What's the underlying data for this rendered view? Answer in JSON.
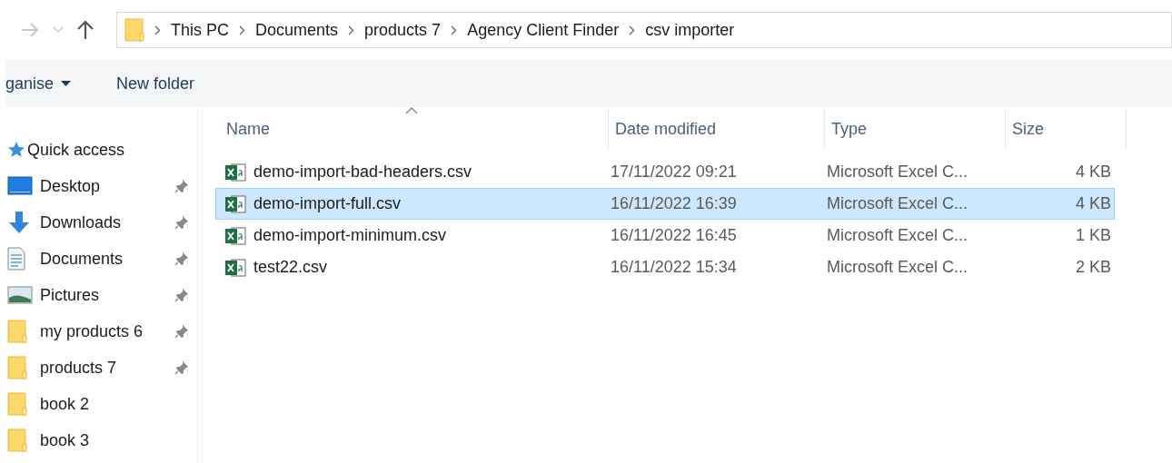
{
  "breadcrumb": [
    "This PC",
    "Documents",
    "products 7",
    "Agency Client Finder",
    "csv importer"
  ],
  "toolbar": {
    "organise": "ganise",
    "new_folder": "New folder"
  },
  "sidebar": {
    "items": [
      {
        "kind": "quick",
        "label": "Quick access",
        "pinned": false
      },
      {
        "kind": "desktop",
        "label": "Desktop",
        "pinned": true
      },
      {
        "kind": "downloads",
        "label": "Downloads",
        "pinned": true
      },
      {
        "kind": "documents",
        "label": "Documents",
        "pinned": true
      },
      {
        "kind": "pictures",
        "label": "Pictures",
        "pinned": true
      },
      {
        "kind": "folder",
        "label": "my products 6",
        "pinned": true
      },
      {
        "kind": "folder",
        "label": "products 7",
        "pinned": true
      },
      {
        "kind": "folder",
        "label": "book 2",
        "pinned": false
      },
      {
        "kind": "folder",
        "label": "book 3",
        "pinned": false
      }
    ]
  },
  "table": {
    "columns": [
      "Name",
      "Date modified",
      "Type",
      "Size"
    ],
    "rows": [
      {
        "name": "demo-import-bad-headers.csv",
        "date": "17/11/2022 09:21",
        "type": "Microsoft Excel C...",
        "size": "4 KB",
        "selected": false
      },
      {
        "name": "demo-import-full.csv",
        "date": "16/11/2022 16:39",
        "type": "Microsoft Excel C...",
        "size": "4 KB",
        "selected": true
      },
      {
        "name": "demo-import-minimum.csv",
        "date": "16/11/2022 16:45",
        "type": "Microsoft Excel C...",
        "size": "1 KB",
        "selected": false
      },
      {
        "name": "test22.csv",
        "date": "16/11/2022 15:34",
        "type": "Microsoft Excel C...",
        "size": "2 KB",
        "selected": false
      }
    ]
  }
}
